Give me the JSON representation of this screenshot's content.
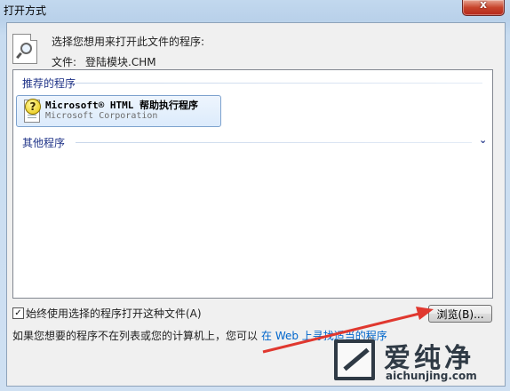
{
  "window": {
    "title": "打开方式",
    "close_glyph": "x"
  },
  "header": {
    "prompt": "选择您想用来打开此文件的程序:",
    "file_label": "文件:",
    "file_name": "登陆模块.CHM",
    "icon": "file-search-icon"
  },
  "program_list": {
    "recommended_header": "推荐的程序",
    "recommended_items": [
      {
        "name": "Microsoft® HTML 帮助执行程序",
        "company": "Microsoft Corporation",
        "icon": "help-document-icon"
      }
    ],
    "other_header": "其他程序",
    "other_expand_icon": "chevron-down-icon",
    "other_expand_glyph": "⌄"
  },
  "options": {
    "always_use_label": "始终使用选择的程序打开这种文件(A)",
    "always_use_checked": true,
    "check_glyph": "✓"
  },
  "buttons": {
    "browse_label": "浏览(B)..."
  },
  "footer": {
    "prefix": "如果您想要的程序不在列表或您的计算机上，您可以",
    "link": "在 Web 上寻找适当的程序",
    "suffix": "。"
  },
  "annotation": {
    "arrow_color": "#e0382f"
  },
  "watermark": {
    "brand": "爱纯净",
    "url": "aichunjing.com"
  },
  "colors": {
    "title_bar": "#b9d1ea",
    "client_bg": "#f0f0f0",
    "group_header": "#1e3287",
    "link": "#0066cc",
    "close_button": "#c7442c"
  }
}
